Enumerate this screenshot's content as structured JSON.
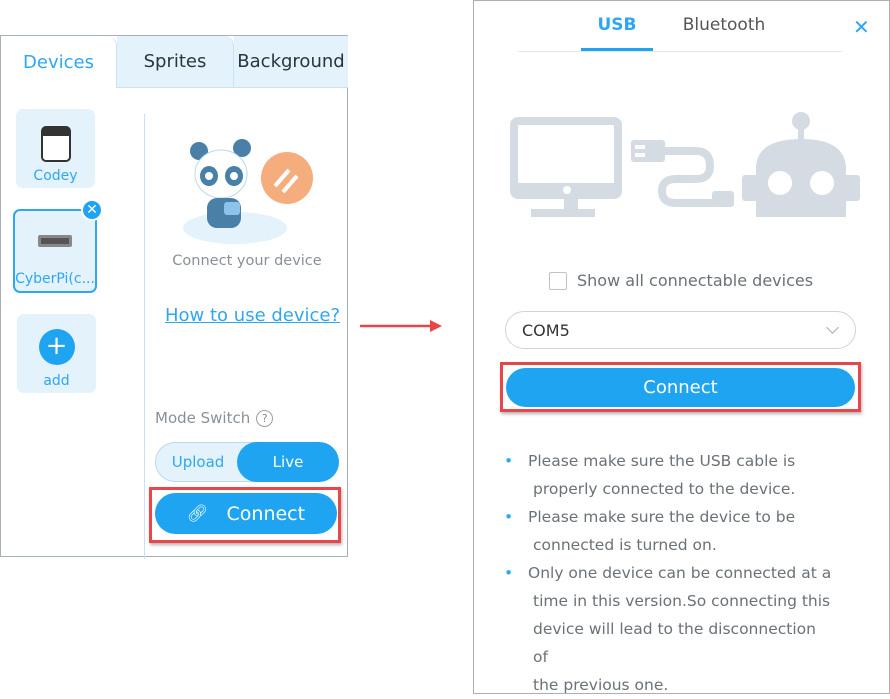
{
  "left_panel": {
    "tabs": [
      {
        "label": "Devices",
        "active": true
      },
      {
        "label": "Sprites"
      },
      {
        "label": "Background"
      }
    ],
    "devices": [
      {
        "label": "Codey"
      },
      {
        "label": "CyberPi(c...",
        "selected": true
      }
    ],
    "add_label": "add",
    "connect_hint": "Connect your device",
    "help_link": "How to use device?",
    "mode_switch_label": "Mode Switch",
    "mode_options": [
      "Upload",
      "Live"
    ],
    "mode_selected": "Live",
    "connect_label": "Connect"
  },
  "dialog": {
    "tabs": [
      {
        "label": "USB",
        "active": true
      },
      {
        "label": "Bluetooth"
      }
    ],
    "show_all_label": "Show all connectable devices",
    "show_all_checked": false,
    "port_value": "COM5",
    "connect_label": "Connect",
    "notes": [
      [
        "Please make sure the USB cable is",
        "properly connected to the device."
      ],
      [
        "Please make sure the device to be",
        "connected is turned on."
      ],
      [
        "Only one device can be connected at a",
        "time in this version.So connecting this",
        "device will lead to the disconnection of",
        "the previous one."
      ]
    ]
  },
  "colors": {
    "accent": "#1fa4f2",
    "highlight": "#e8474a",
    "illustration": "#d5dbe2"
  }
}
